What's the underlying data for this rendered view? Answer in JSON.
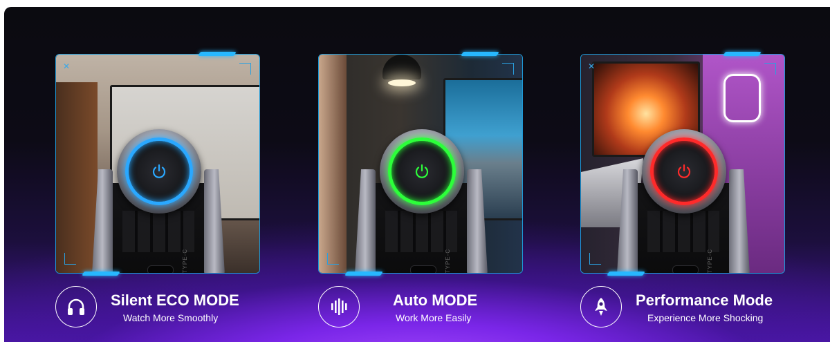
{
  "colors": {
    "frame_accent": "#27b8ff",
    "eco_ring": "#2aa8ff",
    "auto_ring": "#2cff3a",
    "performance_ring": "#ff2a2a",
    "text": "#ffffff"
  },
  "cards": [
    {
      "id": "eco",
      "ring_color": "#2aa8ff",
      "title": "Silent ECO MODE",
      "subtitle": "Watch More Smoothly",
      "icon": "headphones-icon",
      "port_label": "TYPE-C"
    },
    {
      "id": "auto",
      "ring_color": "#2cff3a",
      "title": "Auto MODE",
      "subtitle": "Work More Easily",
      "icon": "sound-bars-icon",
      "port_label": "TYPE-C"
    },
    {
      "id": "performance",
      "ring_color": "#ff2a2a",
      "title": "Performance Mode",
      "subtitle": "Experience More Shocking",
      "icon": "rocket-icon",
      "port_label": "TYPE-C"
    }
  ]
}
